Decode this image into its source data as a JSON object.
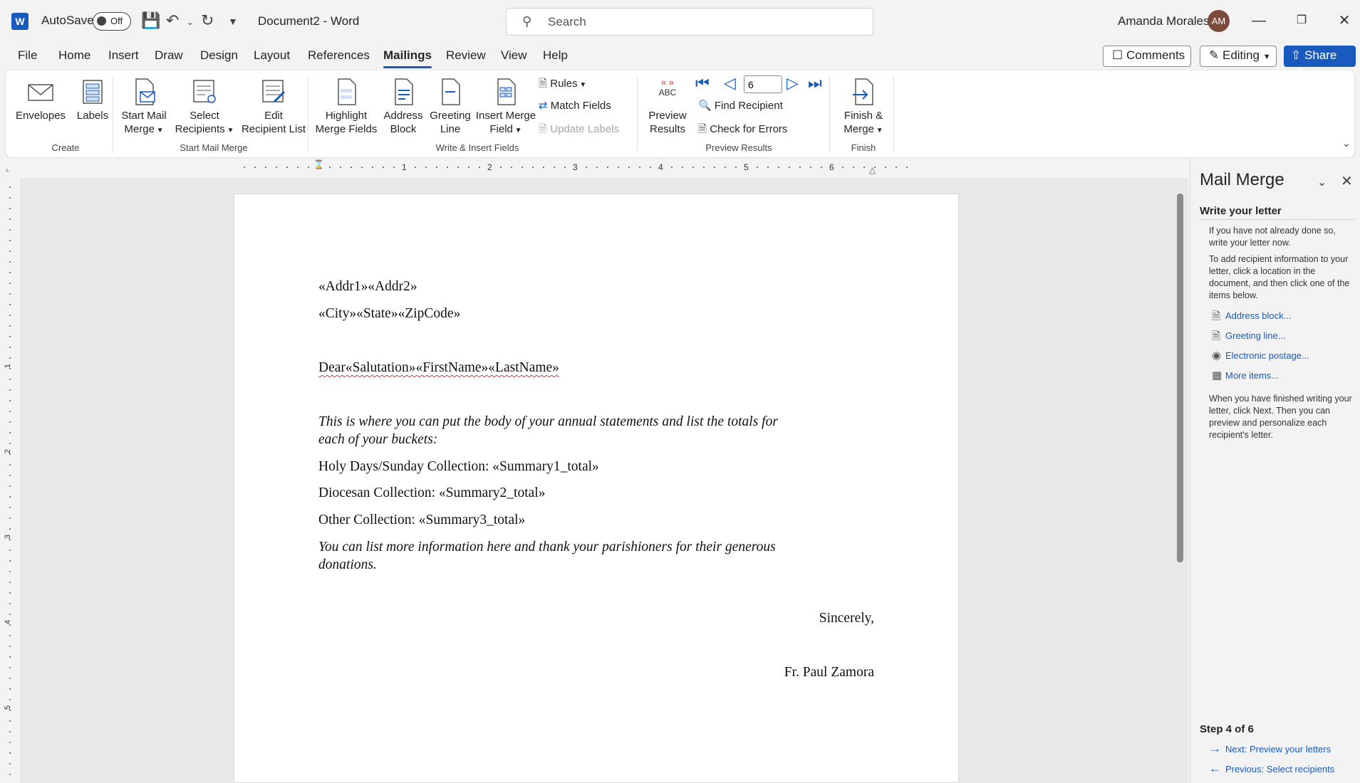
{
  "titlebar": {
    "autosave_label": "AutoSave",
    "autosave_state": "Off",
    "doc_title": "Document2  -  Word",
    "search_placeholder": "Search",
    "user_name": "Amanda Morales",
    "user_initials": "AM"
  },
  "menu": {
    "tabs": [
      "File",
      "Home",
      "Insert",
      "Draw",
      "Design",
      "Layout",
      "References",
      "Mailings",
      "Review",
      "View",
      "Help"
    ],
    "active_tab": "Mailings",
    "comments_label": "Comments",
    "editing_label": "Editing",
    "share_label": "Share"
  },
  "ribbon": {
    "create": {
      "label": "Create",
      "envelopes": "Envelopes",
      "labels": "Labels"
    },
    "start": {
      "label": "Start Mail Merge",
      "start_mail_merge": [
        "Start Mail",
        "Merge"
      ],
      "select_recipients": [
        "Select",
        "Recipients"
      ],
      "edit_recipient_list": [
        "Edit",
        "Recipient List"
      ]
    },
    "write": {
      "label": "Write & Insert Fields",
      "highlight": [
        "Highlight",
        "Merge Fields"
      ],
      "address_block": [
        "Address",
        "Block"
      ],
      "greeting_line": [
        "Greeting",
        "Line"
      ],
      "insert_merge_field": [
        "Insert Merge",
        "Field"
      ],
      "rules": "Rules",
      "match_fields": "Match Fields",
      "update_labels": "Update Labels"
    },
    "preview": {
      "label": "Preview Results",
      "preview_results": [
        "Preview",
        "Results"
      ],
      "abc_text": "ABC",
      "record_value": "6",
      "find_recipient": "Find Recipient",
      "check_errors": "Check for Errors"
    },
    "finish": {
      "label": "Finish",
      "finish_merge": [
        "Finish &",
        "Merge"
      ]
    }
  },
  "ruler": {
    "h_numbers": [
      "1",
      "2",
      "3",
      "4",
      "5",
      "6"
    ],
    "v_numbers": [
      "1",
      "2",
      "3",
      "4",
      "5"
    ]
  },
  "document": {
    "addr_line": "«Addr1»«Addr2»",
    "city_line": "«City»«State»«ZipCode»",
    "greeting": "Dear«Salutation»«FirstName»«LastName»",
    "body_1": "This is where you can put the body of your annual statements and list the totals for",
    "body_2": "each of your buckets:",
    "holy_days": "Holy Days/Sunday Collection: «Summary1_total»",
    "diocesan": "Diocesan Collection: «Summary2_total»",
    "other": "Other Collection: «Summary3_total»",
    "closing_1": "You can list more information here and thank your parishioners for their generous",
    "closing_2": "donations.",
    "sincerely": "Sincerely,",
    "signature": "Fr. Paul Zamora"
  },
  "pane": {
    "title": "Mail Merge",
    "heading": "Write your letter",
    "p1": "If you have not already done so, write your letter now.",
    "p2": "To add recipient information to your letter, click a location in the document, and then click one of the items below.",
    "links": [
      "Address block...",
      "Greeting line...",
      "Electronic postage...",
      "More items..."
    ],
    "p3": "When you have finished writing your letter, click Next. Then you can preview and personalize each recipient's letter.",
    "step": "Step 4 of 6",
    "next": "Next: Preview your letters",
    "previous": "Previous: Select recipients"
  }
}
